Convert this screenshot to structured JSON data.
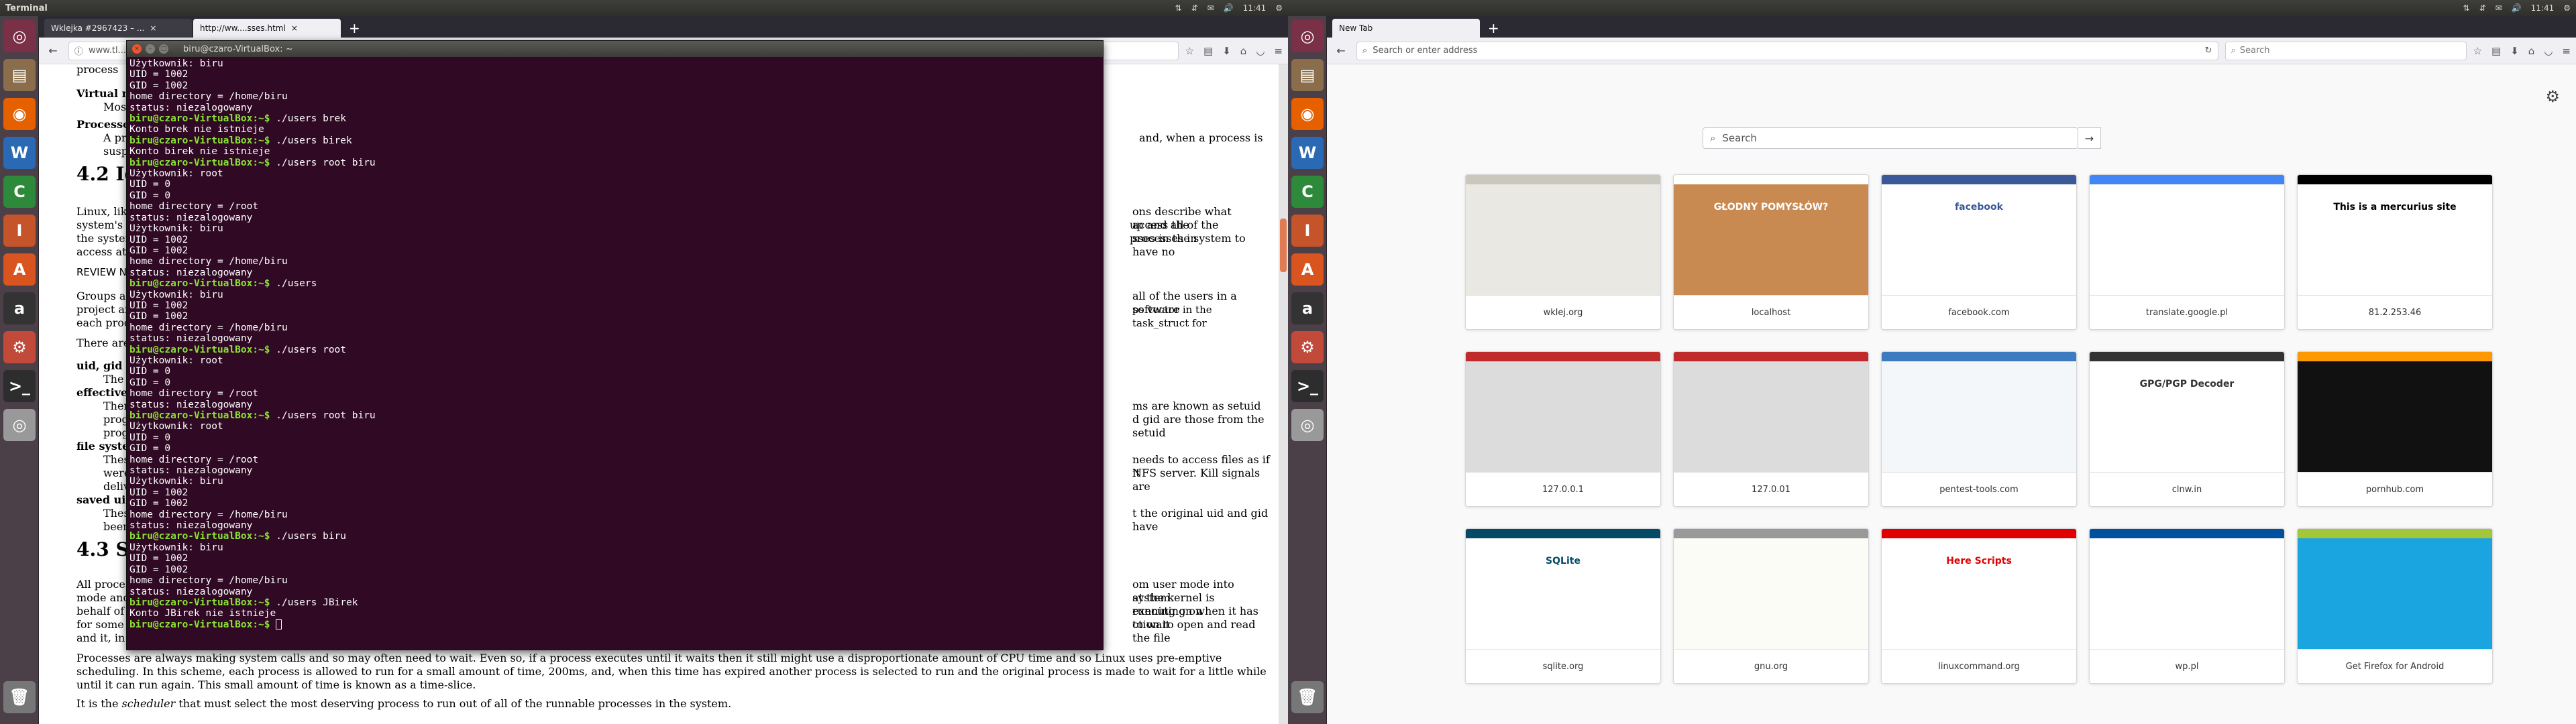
{
  "left_screen": {
    "panel_title": "Terminal",
    "clock": "11:41",
    "launcher": [
      {
        "name": "dash-icon",
        "glyph": "◎",
        "color": "#7a3148"
      },
      {
        "name": "files-icon",
        "glyph": "▤",
        "color": "#8a6d4a"
      },
      {
        "name": "firefox-icon",
        "glyph": "◉",
        "color": "#e66000"
      },
      {
        "name": "writer-icon",
        "glyph": "W",
        "color": "#2a6ab5"
      },
      {
        "name": "calc-icon",
        "glyph": "C",
        "color": "#2c8a3a"
      },
      {
        "name": "impress-icon",
        "glyph": "I",
        "color": "#c5542a"
      },
      {
        "name": "software-center-icon",
        "glyph": "A",
        "color": "#d9541e"
      },
      {
        "name": "amazon-icon",
        "glyph": "a",
        "color": "#333"
      },
      {
        "name": "settings-icon",
        "glyph": "⚙",
        "color": "#c24a3a"
      },
      {
        "name": "terminal-icon",
        "glyph": ">_",
        "color": "#2d2d2d"
      },
      {
        "name": "dvd-icon",
        "glyph": "◎",
        "color": "#999"
      },
      {
        "name": "trash-icon",
        "glyph": "🗑",
        "color": "#777"
      }
    ],
    "browser": {
      "tabs": [
        {
          "label": "Wklejka #2967423 – ...",
          "active": false
        },
        {
          "label": "http://ww....sses.html",
          "active": true
        }
      ],
      "url": "www.tl...",
      "doc": {
        "lines_a": [
          "process",
          "UID = 1002"
        ],
        "virtual_mem": "Virtual mem",
        "most_proc": "Most proc",
        "processor_s": "Processor S",
        "a_process": "A process",
        "suspende": "suspende",
        "right_1": "and, when a process is",
        "section_42": "4.2  Ide",
        "linux_like": "Linux, like al",
        "right_2": "ons describe what access the",
        "systems_s": "system's s",
        "right_3": "up and all of the processes in",
        "the_system": "the system. E",
        "right_4": "sses in the system to have no",
        "access_at_all": "access at all.",
        "review_note": "REVIEW NOTE",
        "groups_are": "Groups are Li",
        "right_5": "all of the users in a software",
        "project_and": "project and ar",
        "right_6": "ps vector in the task_struct for",
        "each_process": "each process.",
        "there_are_fou": "There are fou",
        "uid_gid": "uid, gid",
        "the_user": "The user",
        "effective_uid": "effective uid",
        "there_are_1": "There are",
        "right_7": "ms are known as setuid",
        "program_1": "program",
        "right_8": "d gid are those from the setuid",
        "program_2": "program",
        "file_system_u": "file system u",
        "these_are": "These are",
        "right_9": "needs to access files as if it",
        "were_a_p": "were a p",
        "right_10": "NFS server. Kill signals are",
        "delivered": "delivered",
        "saved_uid_and": "saved uid and",
        "these_are_2": "These are",
        "right_11": "t the original uid and gid have",
        "been_cha": "been cha",
        "section_43": "4.3  Sch",
        "all_processes": "All processes",
        "right_12": "om user mode into system",
        "mode_and": "mode and bein",
        "right_13": "at the kernel is executing on",
        "behalf_of_the": "behalf of the",
        "right_14": "running on when it has to wait",
        "for_some_sys": "for some syst",
        "right_15": "ction to open and read the file",
        "and_it_in_turn": "and it, in turn",
        "para_full": "Processes are always making system calls and so may often need to wait. Even so, if a process executes until it waits then it still might use a disproportionate amount of CPU time and so Linux uses pre-emptive scheduling. In this scheme, each process is allowed to run for a small amount of time, 200ms, and, when this time has expired another process is selected to run and the original process is made to wait for a little while until it can run again. This small amount of time is known as a time-slice.",
        "para_last_a": "It is the ",
        "para_last_em": "scheduler",
        "para_last_b": " that must select the most deserving process to run out of all of the runnable processes in the system."
      }
    },
    "terminal": {
      "title": "biru@czaro-VirtualBox: ~",
      "lines": [
        {
          "t": "out",
          "s": "Użytkownik: biru"
        },
        {
          "t": "out",
          "s": "UID = 1002"
        },
        {
          "t": "out",
          "s": "GID = 1002"
        },
        {
          "t": "out",
          "s": "home directory = /home/biru"
        },
        {
          "t": "out",
          "s": "status: niezalogowany"
        },
        {
          "t": "cmd",
          "p": "biru@czaro-VirtualBox:~$",
          "s": " ./users brek"
        },
        {
          "t": "out",
          "s": "Konto brek nie istnieje"
        },
        {
          "t": "cmd",
          "p": "biru@czaro-VirtualBox:~$",
          "s": " ./users birek"
        },
        {
          "t": "out",
          "s": "Konto birek nie istnieje"
        },
        {
          "t": "cmd",
          "p": "biru@czaro-VirtualBox:~$",
          "s": " ./users root biru"
        },
        {
          "t": "out",
          "s": "Użytkownik: root"
        },
        {
          "t": "out",
          "s": "UID = 0"
        },
        {
          "t": "out",
          "s": "GID = 0"
        },
        {
          "t": "out",
          "s": "home directory = /root"
        },
        {
          "t": "out",
          "s": "status: niezalogowany"
        },
        {
          "t": "out",
          "s": "Użytkownik: biru"
        },
        {
          "t": "out",
          "s": "UID = 1002"
        },
        {
          "t": "out",
          "s": "GID = 1002"
        },
        {
          "t": "out",
          "s": "home directory = /home/biru"
        },
        {
          "t": "out",
          "s": "status: niezalogowany"
        },
        {
          "t": "cmd",
          "p": "biru@czaro-VirtualBox:~$",
          "s": " ./users"
        },
        {
          "t": "out",
          "s": "Użytkownik: biru"
        },
        {
          "t": "out",
          "s": "UID = 1002"
        },
        {
          "t": "out",
          "s": "GID = 1002"
        },
        {
          "t": "out",
          "s": "home directory = /home/biru"
        },
        {
          "t": "out",
          "s": "status: niezalogowany"
        },
        {
          "t": "cmd",
          "p": "biru@czaro-VirtualBox:~$",
          "s": " ./users root"
        },
        {
          "t": "out",
          "s": "Użytkownik: root"
        },
        {
          "t": "out",
          "s": "UID = 0"
        },
        {
          "t": "out",
          "s": "GID = 0"
        },
        {
          "t": "out",
          "s": "home directory = /root"
        },
        {
          "t": "out",
          "s": "status: niezalogowany"
        },
        {
          "t": "cmd",
          "p": "biru@czaro-VirtualBox:~$",
          "s": " ./users root biru"
        },
        {
          "t": "out",
          "s": "Użytkownik: root"
        },
        {
          "t": "out",
          "s": "UID = 0"
        },
        {
          "t": "out",
          "s": "GID = 0"
        },
        {
          "t": "out",
          "s": "home directory = /root"
        },
        {
          "t": "out",
          "s": "status: niezalogowany"
        },
        {
          "t": "out",
          "s": "Użytkownik: biru"
        },
        {
          "t": "out",
          "s": "UID = 1002"
        },
        {
          "t": "out",
          "s": "GID = 1002"
        },
        {
          "t": "out",
          "s": "home directory = /home/biru"
        },
        {
          "t": "out",
          "s": "status: niezalogowany"
        },
        {
          "t": "cmd",
          "p": "biru@czaro-VirtualBox:~$",
          "s": " ./users biru"
        },
        {
          "t": "out",
          "s": "Użytkownik: biru"
        },
        {
          "t": "out",
          "s": "UID = 1002"
        },
        {
          "t": "out",
          "s": "GID = 1002"
        },
        {
          "t": "out",
          "s": "home directory = /home/biru"
        },
        {
          "t": "out",
          "s": "status: niezalogowany"
        },
        {
          "t": "cmd",
          "p": "biru@czaro-VirtualBox:~$",
          "s": " ./users JBirek"
        },
        {
          "t": "out",
          "s": "Konto JBirek nie istnieje"
        },
        {
          "t": "cur",
          "p": "biru@czaro-VirtualBox:~$",
          "s": " "
        }
      ]
    }
  },
  "right_screen": {
    "clock": "11:41",
    "browser": {
      "tab_label": "New Tab",
      "url_placeholder": "Search or enter address",
      "search_placeholder": "Search",
      "page_search_placeholder": "Search",
      "tiles": [
        {
          "label": "wklej.org",
          "bg": "#e9e8e2",
          "accent": "#c9c7be"
        },
        {
          "label": "localhost",
          "bg": "#c98a52",
          "accent": "#fff",
          "text": "GŁODNY POMYSŁÓW?"
        },
        {
          "label": "facebook.com",
          "bg": "#ffffff",
          "accent": "#3b5998",
          "text": "facebook"
        },
        {
          "label": "translate.google.pl",
          "bg": "#ffffff",
          "accent": "#4285f4"
        },
        {
          "label": "81.2.253.46",
          "bg": "#ffffff",
          "accent": "#000",
          "text": "This is a mercurius site"
        },
        {
          "label": "127.0.0.1",
          "bg": "#dcdcdc",
          "accent": "#c02a2a"
        },
        {
          "label": "127.0.01",
          "bg": "#dcdcdc",
          "accent": "#c02a2a"
        },
        {
          "label": "pentest-tools.com",
          "bg": "#f4f7fa",
          "accent": "#3c7bbf"
        },
        {
          "label": "clnw.in",
          "bg": "#ffffff",
          "accent": "#333",
          "text": "GPG/PGP Decoder"
        },
        {
          "label": "pornhub.com",
          "bg": "#111111",
          "accent": "#f90"
        },
        {
          "label": "sqlite.org",
          "bg": "#ffffff",
          "accent": "#044a64",
          "text": "SQLite"
        },
        {
          "label": "gnu.org",
          "bg": "#fcfcf6",
          "accent": "#999"
        },
        {
          "label": "linuxcommand.org",
          "bg": "#ffffff",
          "accent": "#e00000",
          "text": "Here Scripts"
        },
        {
          "label": "wp.pl",
          "bg": "#ffffff",
          "accent": "#0050a0"
        },
        {
          "label": "Get Firefox for Android",
          "bg": "#1aa4e0",
          "accent": "#a4c639"
        }
      ]
    }
  }
}
